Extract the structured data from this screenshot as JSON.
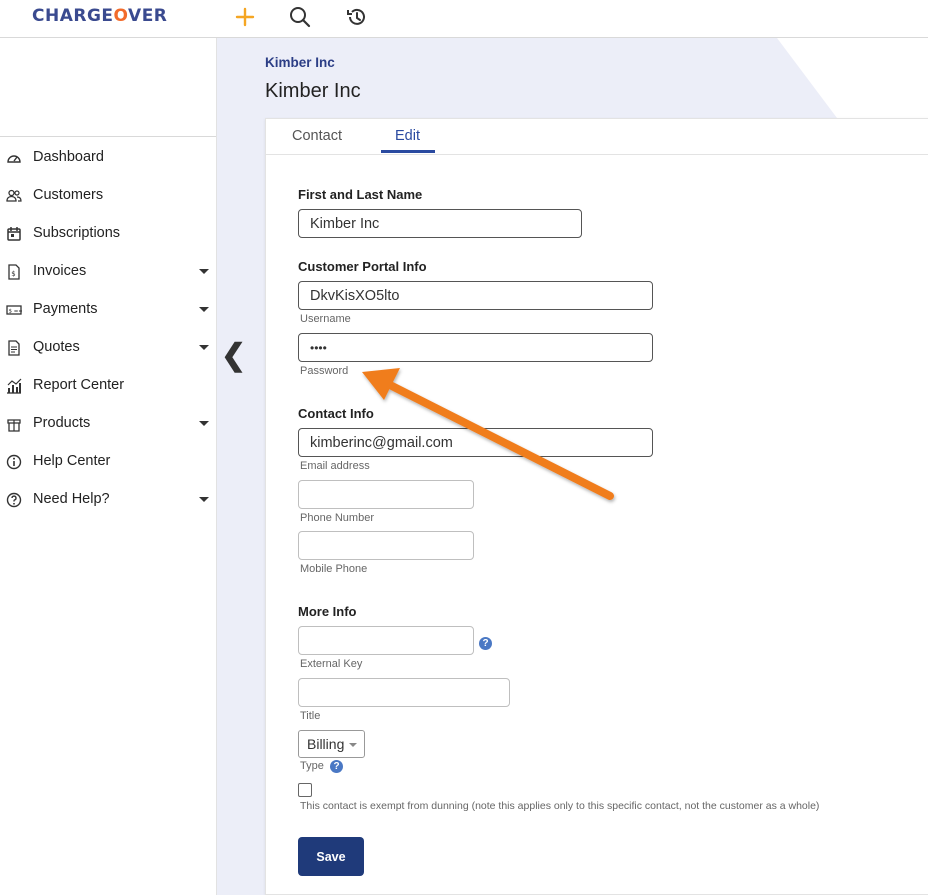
{
  "header": {
    "logo_prefix": "CHARGE",
    "logo_o": "O",
    "logo_suffix": "VER"
  },
  "sidebar": {
    "items": [
      {
        "label": "Dashboard",
        "icon": "dashboard-icon"
      },
      {
        "label": "Customers",
        "icon": "customers-icon"
      },
      {
        "label": "Subscriptions",
        "icon": "calendar-icon"
      },
      {
        "label": "Invoices",
        "icon": "invoice-icon"
      },
      {
        "label": "Payments",
        "icon": "payment-icon"
      },
      {
        "label": "Quotes",
        "icon": "document-icon"
      },
      {
        "label": "Report Center",
        "icon": "chart-icon"
      },
      {
        "label": "Products",
        "icon": "box-icon"
      },
      {
        "label": "Help Center",
        "icon": "info-icon"
      },
      {
        "label": "Need Help?",
        "icon": "question-icon"
      }
    ]
  },
  "page": {
    "breadcrumb": "Kimber Inc",
    "title": "Kimber Inc",
    "tabs": [
      {
        "label": "Contact"
      },
      {
        "label": "Edit"
      }
    ]
  },
  "form": {
    "name_section": "First and Last Name",
    "name_value": "Kimber Inc",
    "portal_section": "Customer Portal Info",
    "username_value": "DkvKisXO5lto",
    "username_hint": "Username",
    "password_value": "••••",
    "password_hint": "Password",
    "contact_section": "Contact Info",
    "email_value": "kimberinc@gmail.com",
    "email_hint": "Email address",
    "phone_hint": "Phone Number",
    "mobile_hint": "Mobile Phone",
    "more_section": "More Info",
    "external_key_hint": "External Key",
    "title_hint": "Title",
    "type_value": "Billing",
    "type_hint": "Type",
    "help_glyph": "?",
    "dunning_text": "This contact is exempt from dunning (note this applies only to this specific contact, not the customer as a whole)",
    "save_label": "Save"
  },
  "colors": {
    "brand": "#3a4a8f",
    "accent": "#f26b2b",
    "primary_button": "#1f3a7a",
    "arrow": "#f07d1e"
  }
}
